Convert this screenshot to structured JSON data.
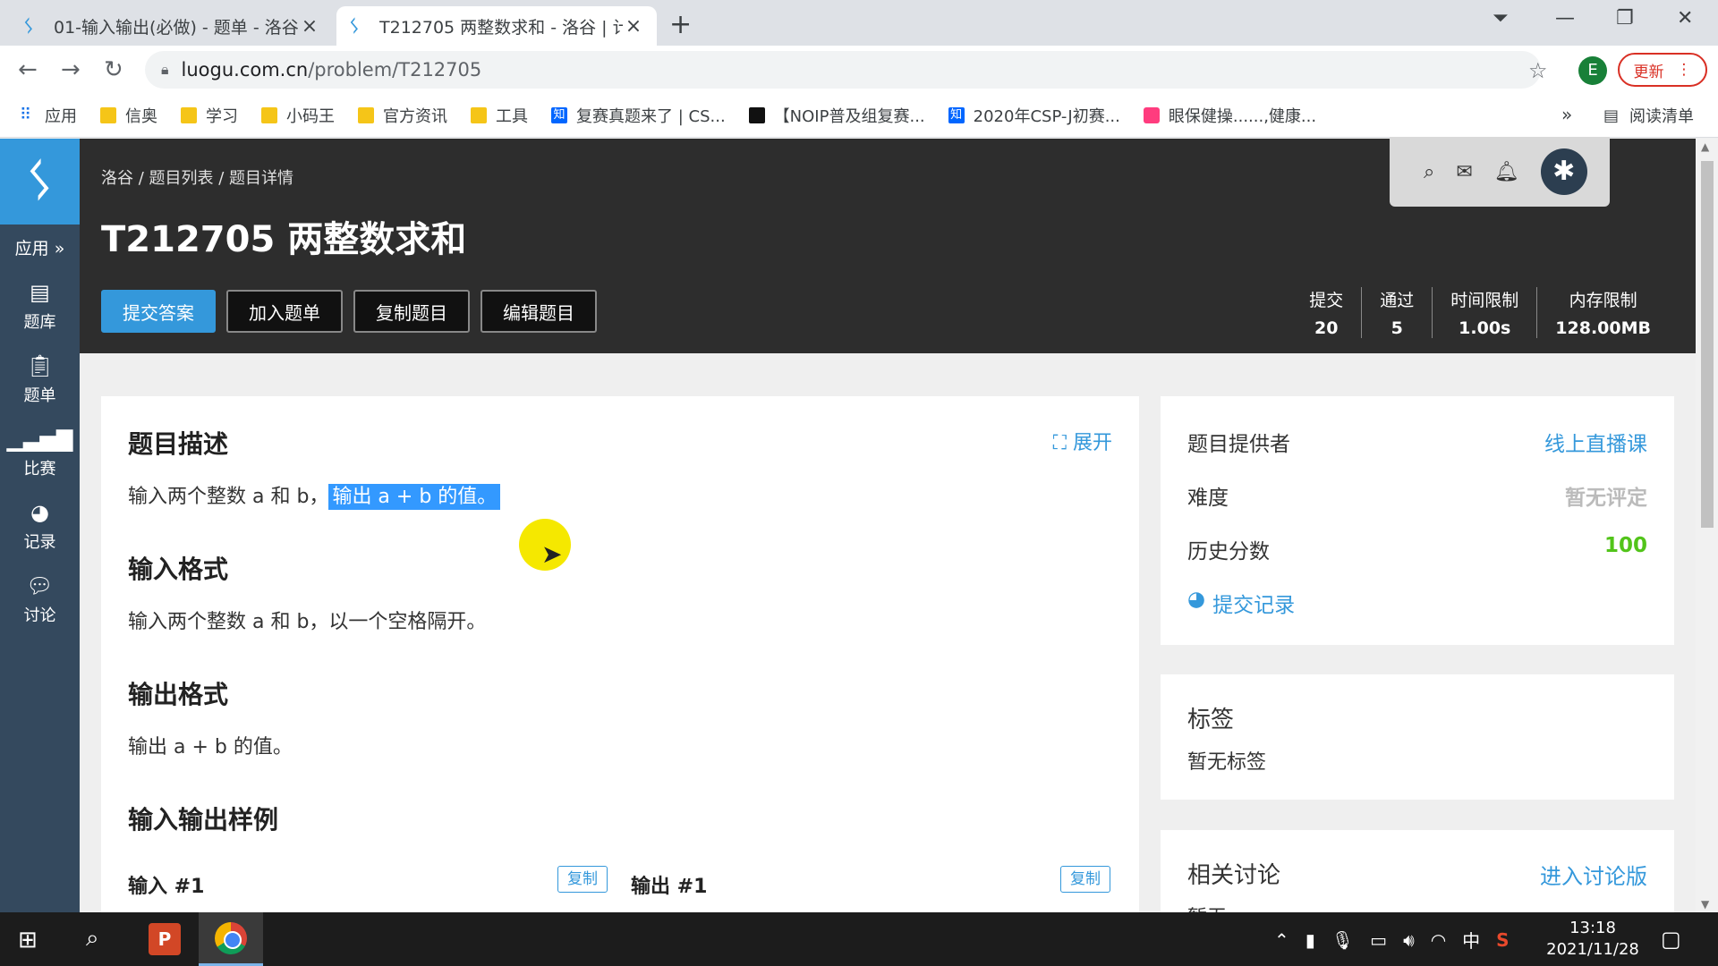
{
  "browser": {
    "tabs": [
      {
        "title": "01-输入输出(必做) - 题单 - 洛谷",
        "active": false
      },
      {
        "title": "T212705 两整数求和 - 洛谷 | 计",
        "active": true
      }
    ],
    "new_tab": "+",
    "url_domain": "luogu.com.cn",
    "url_path": "/problem/T212705",
    "profile_letter": "E",
    "update_label": "更新",
    "bookmarks": [
      {
        "label": "应用",
        "icon": "apps-grid-icon"
      },
      {
        "label": "信奥",
        "icon": "folder-icon"
      },
      {
        "label": "学习",
        "icon": "folder-icon"
      },
      {
        "label": "小码王",
        "icon": "folder-icon"
      },
      {
        "label": "官方资讯",
        "icon": "folder-icon"
      },
      {
        "label": "工具",
        "icon": "folder-icon"
      },
      {
        "label": "复赛真题来了 | CS...",
        "icon": "zhihu-icon"
      },
      {
        "label": "【NOIP普及组复赛...",
        "icon": "ccf-icon"
      },
      {
        "label": "2020年CSP-J初赛...",
        "icon": "zhihu-icon"
      },
      {
        "label": "眼保健操......,健康...",
        "icon": "bilibili-icon"
      }
    ],
    "more_bookmarks": "»",
    "reading_list": "阅读清单"
  },
  "sidebar": {
    "logo": "ᛊ",
    "apps_label": "应用 »",
    "items": [
      {
        "label": "题库",
        "icon": "book-icon"
      },
      {
        "label": "题单",
        "icon": "clipboard-icon"
      },
      {
        "label": "比赛",
        "icon": "bar-chart-icon"
      },
      {
        "label": "记录",
        "icon": "pie-chart-icon"
      },
      {
        "label": "讨论",
        "icon": "chat-icon"
      }
    ]
  },
  "header": {
    "breadcrumb": "洛谷 / 题目列表 / 题目详情",
    "title": "T212705 两整数求和",
    "buttons": [
      "提交答案",
      "加入题单",
      "复制题目",
      "编辑题目"
    ],
    "stats": [
      {
        "label": "提交",
        "value": "20"
      },
      {
        "label": "通过",
        "value": "5"
      },
      {
        "label": "时间限制",
        "value": "1.00s"
      },
      {
        "label": "内存限制",
        "value": "128.00MB"
      }
    ]
  },
  "problem": {
    "expand_label": "展开",
    "description_title": "题目描述",
    "description_plain": "输入两个整数 a 和 b，",
    "description_highlight": "输出 a + b 的值。",
    "input_title": "输入格式",
    "input_text": "输入两个整数 a 和 b，以一个空格隔开。",
    "output_title": "输出格式",
    "output_text": "输出 a + b 的值。",
    "samples_title": "输入输出样例",
    "sample_input_label": "输入 #1",
    "sample_output_label": "输出 #1",
    "copy_label": "复制"
  },
  "info": {
    "provider_label": "题目提供者",
    "provider_value": "线上直播课",
    "difficulty_label": "难度",
    "difficulty_value": "暂无评定",
    "history_label": "历史分数",
    "history_value": "100",
    "records_link": "提交记录"
  },
  "tags": {
    "title": "标签",
    "empty": "暂无标签"
  },
  "discussion": {
    "title": "相关讨论",
    "link": "进入讨论版",
    "partial": "暂无"
  },
  "taskbar": {
    "ime": "中",
    "time": "13:18",
    "date": "2021/11/28"
  },
  "colors": {
    "accent": "#3498db",
    "sidebar": "#34495e",
    "header": "#2d2d2d",
    "success": "#52c41a"
  }
}
